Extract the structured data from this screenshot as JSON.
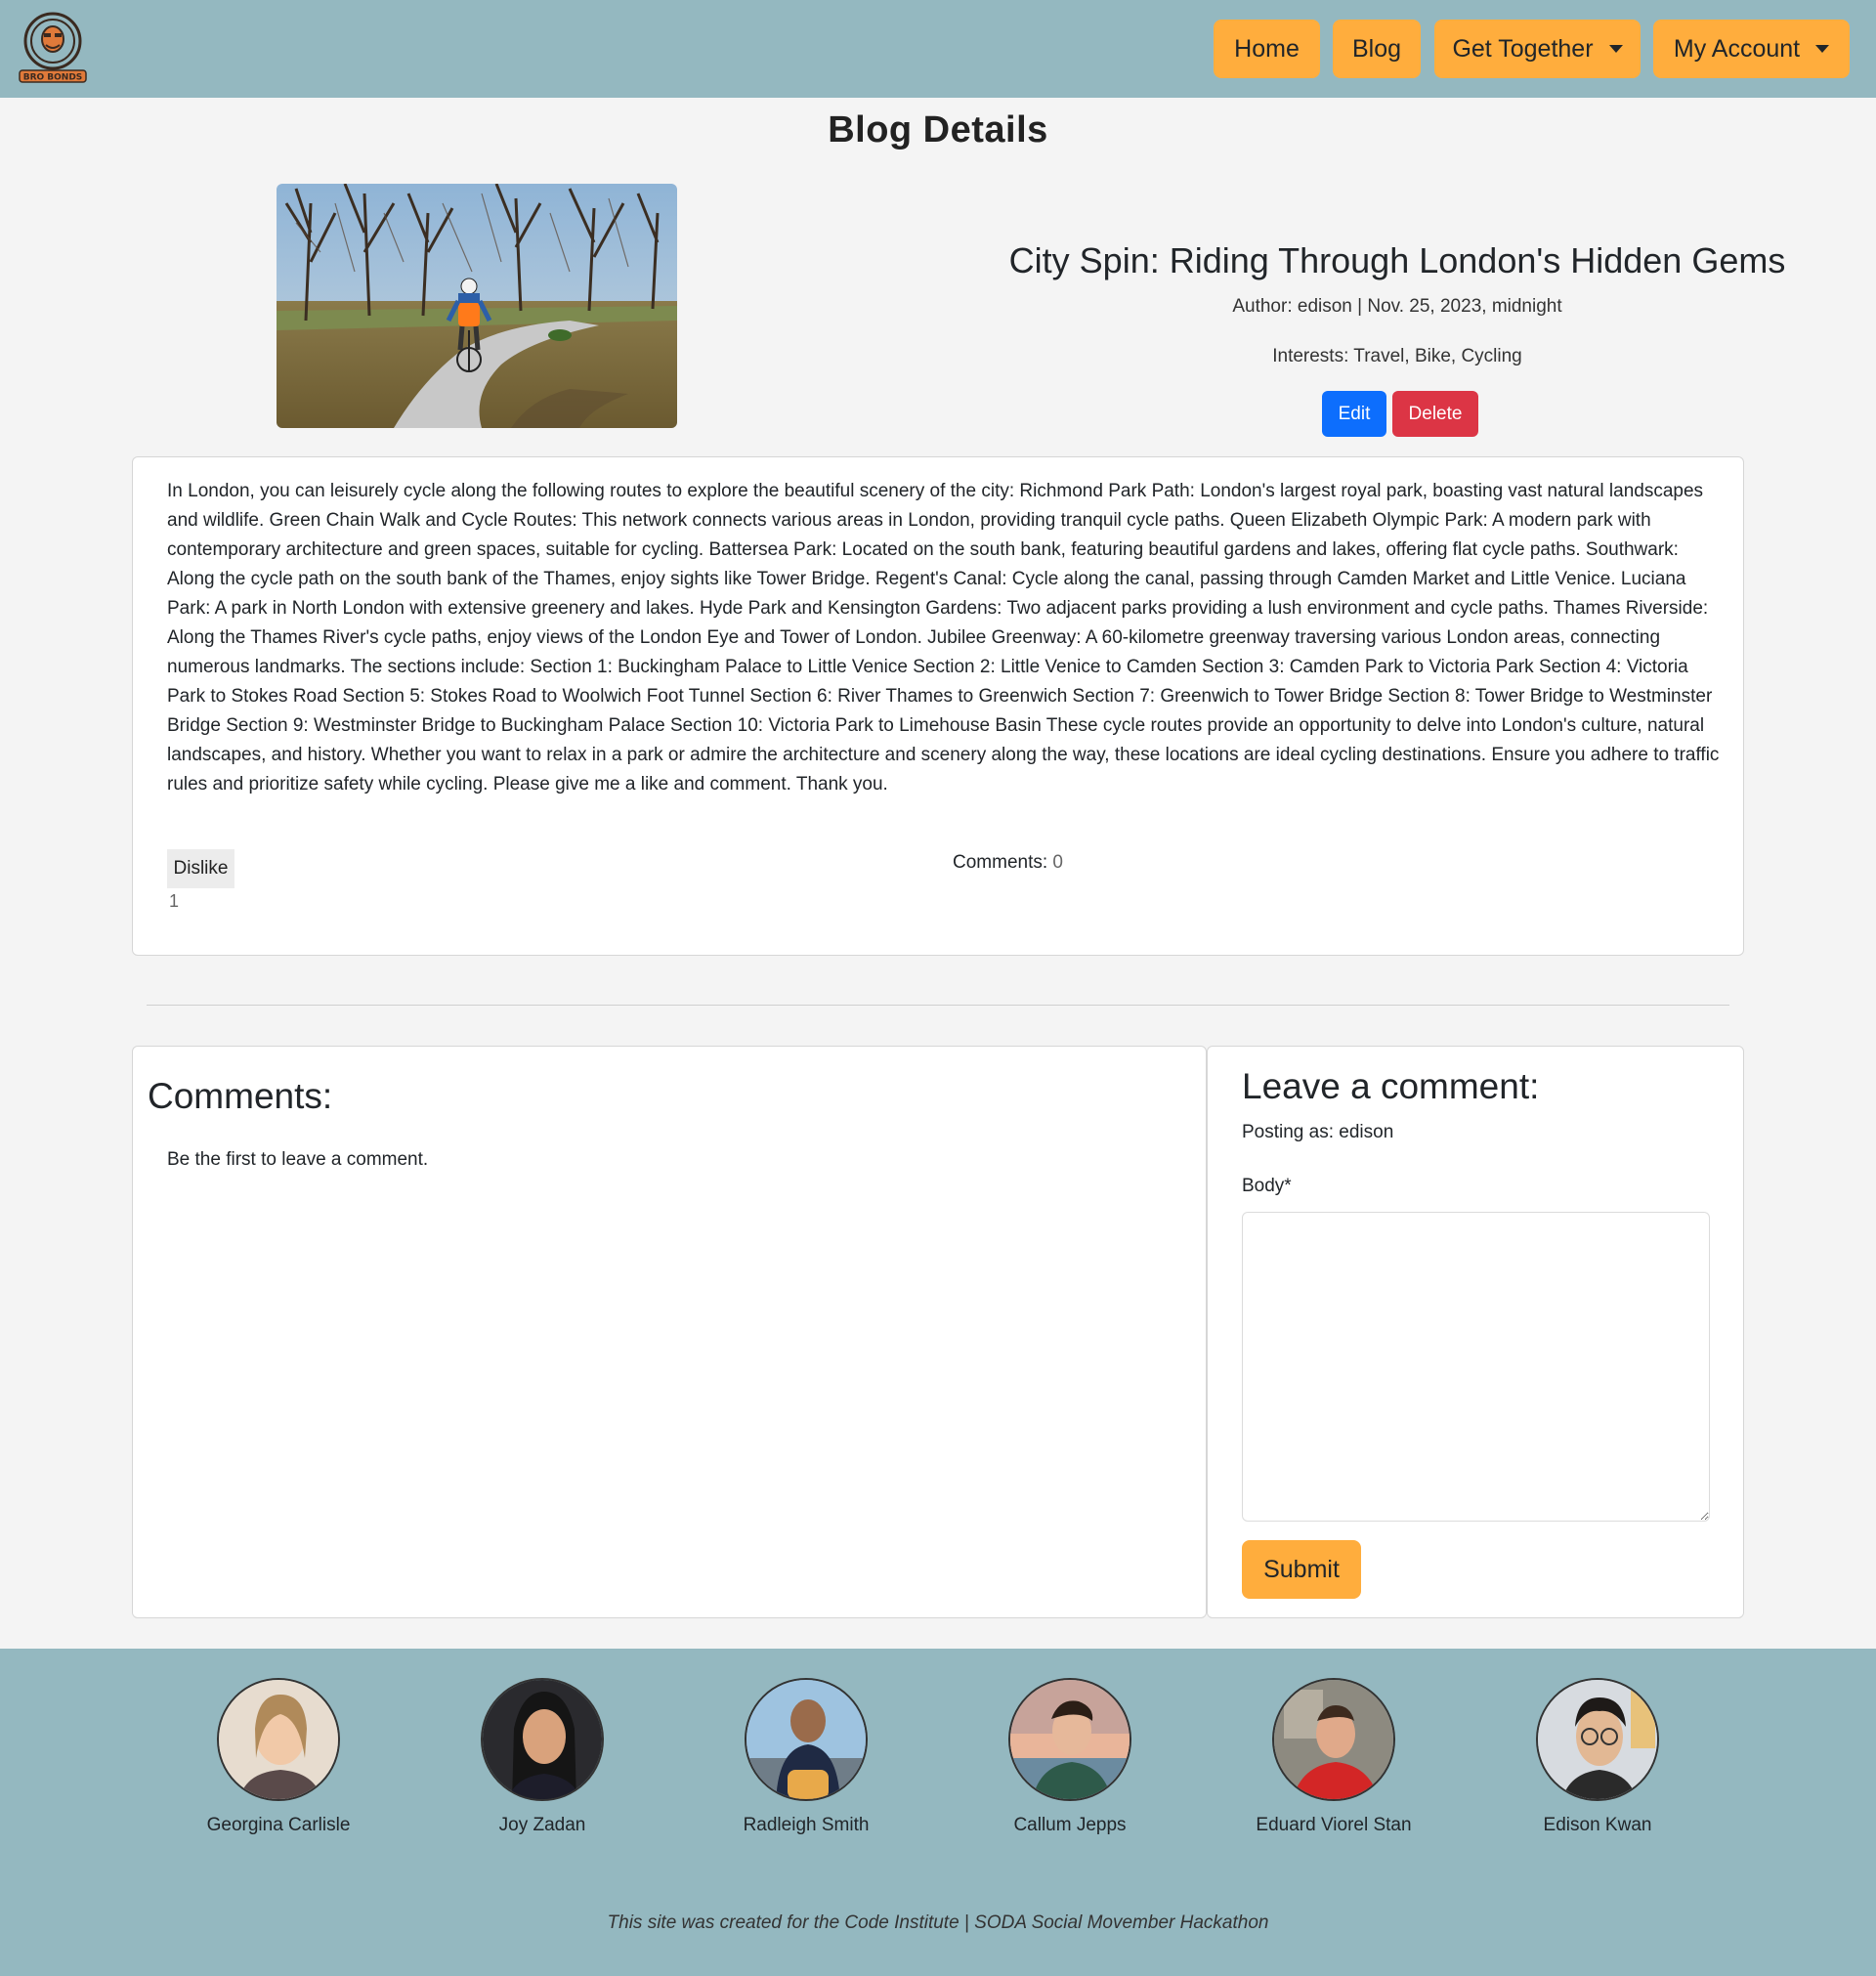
{
  "nav": {
    "logo_text": "BRO BONDS",
    "home": "Home",
    "blog": "Blog",
    "get_together": "Get Together",
    "my_account": "My Account"
  },
  "page_title": "Blog Details",
  "post": {
    "title": "City Spin: Riding Through London's Hidden Gems",
    "meta": "Author: edison | Nov. 25, 2023, midnight",
    "interests": "Interests: Travel, Bike, Cycling",
    "edit_label": "Edit",
    "delete_label": "Delete",
    "body": "In London, you can leisurely cycle along the following routes to explore the beautiful scenery of the city: Richmond Park Path: London's largest royal park, boasting vast natural landscapes and wildlife. Green Chain Walk and Cycle Routes: This network connects various areas in London, providing tranquil cycle paths. Queen Elizabeth Olympic Park: A modern park with contemporary architecture and green spaces, suitable for cycling. Battersea Park: Located on the south bank, featuring beautiful gardens and lakes, offering flat cycle paths. Southwark: Along the cycle path on the south bank of the Thames, enjoy sights like Tower Bridge. Regent's Canal: Cycle along the canal, passing through Camden Market and Little Venice. Luciana Park: A park in North London with extensive greenery and lakes. Hyde Park and Kensington Gardens: Two adjacent parks providing a lush environment and cycle paths. Thames Riverside: Along the Thames River's cycle paths, enjoy views of the London Eye and Tower of London. Jubilee Greenway: A 60-kilometre greenway traversing various London areas, connecting numerous landmarks. The sections include: Section 1: Buckingham Palace to Little Venice Section 2: Little Venice to Camden Section 3: Camden Park to Victoria Park Section 4: Victoria Park to Stokes Road Section 5: Stokes Road to Woolwich Foot Tunnel Section 6: River Thames to Greenwich Section 7: Greenwich to Tower Bridge Section 8: Tower Bridge to Westminster Bridge Section 9: Westminster Bridge to Buckingham Palace Section 10: Victoria Park to Limehouse Basin These cycle routes provide an opportunity to delve into London's culture, natural landscapes, and history. Whether you want to relax in a park or admire the architecture and scenery along the way, these locations are ideal cycling destinations. Ensure you adhere to traffic rules and prioritize safety while cycling. Please give me a like and comment. Thank you.",
    "dislike_label": "Dislike",
    "like_count": "1",
    "comments_label": "Comments: ",
    "comments_count": "0"
  },
  "comments": {
    "heading": "Comments:",
    "empty": "Be the first to leave a comment."
  },
  "comment_form": {
    "heading": "Leave a comment:",
    "posting_as": "Posting as: edison",
    "body_label": "Body*",
    "body_value": "",
    "submit_label": "Submit"
  },
  "team": [
    {
      "name": "Georgina Carlisle"
    },
    {
      "name": "Joy Zadan"
    },
    {
      "name": "Radleigh Smith"
    },
    {
      "name": "Callum Jepps"
    },
    {
      "name": "Eduard Viorel Stan"
    },
    {
      "name": "Edison Kwan"
    }
  ],
  "footer_note": "This site was created for the Code Institute | SODA Social Movember Hackathon",
  "colors": {
    "nav_bg": "#94b8c0",
    "accent": "#ffad3d",
    "edit": "#0d6efd",
    "delete": "#dc3545",
    "page_bg": "#f4f4f4"
  }
}
